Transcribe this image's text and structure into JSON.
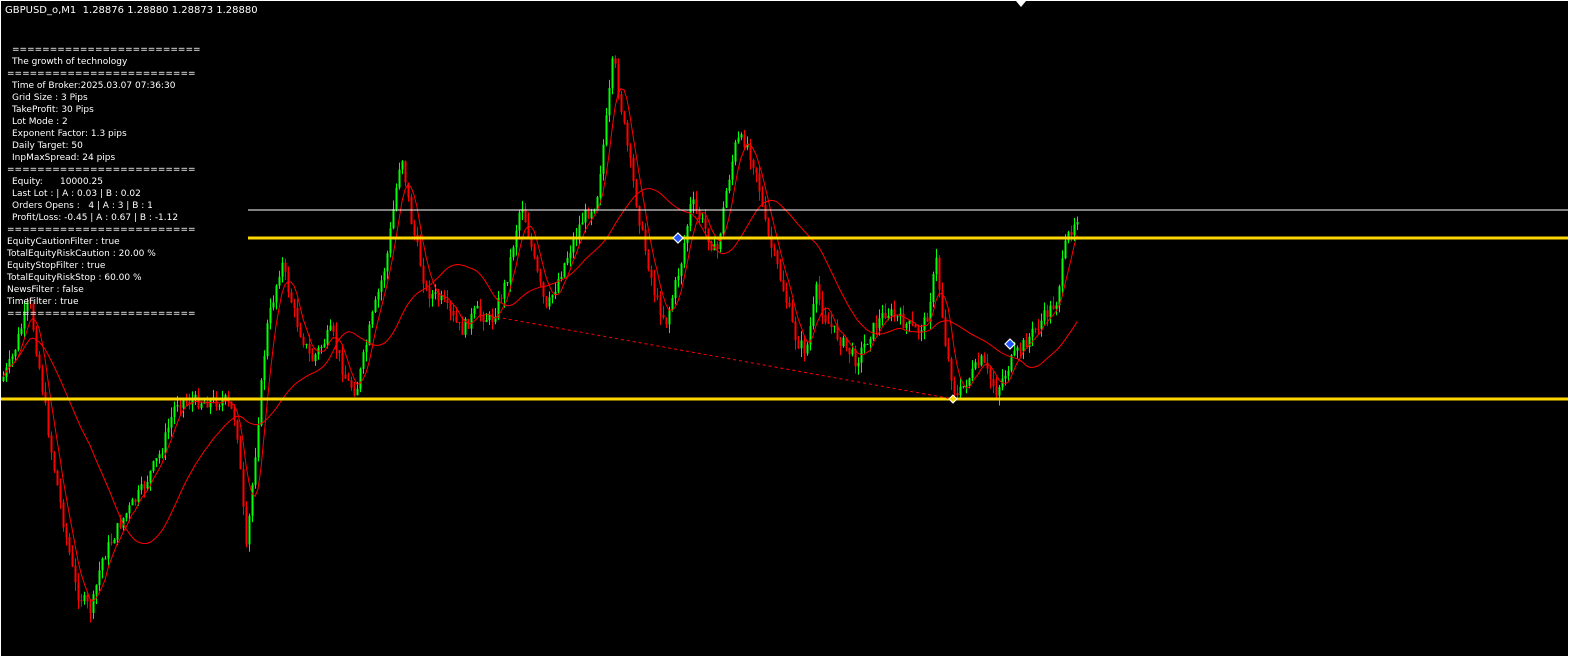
{
  "header": {
    "symbol": "GBPUSD_o,M1",
    "quote": "1.28876 1.28880 1.28873 1.28880"
  },
  "info_panel": {
    "sep_a": "=========================",
    "title": "The growth of technology",
    "sep_b": "=========================",
    "settings": [
      "Time of Broker:2025.03.07 07:36:30",
      "Grid Size : 3 Pips",
      "TakeProfit: 30 Pips",
      "Lot Mode : 2",
      "Exponent Factor: 1.3 pips",
      "Daily Target: 50",
      "InpMaxSpread: 24 pips"
    ],
    "sep_c": "=========================",
    "stats": [
      "Equity:      10000.25",
      "Last Lot : | A : 0.03 | B : 0.02",
      "Orders Opens :   4 | A : 3 | B : 1",
      "Profit/Loss: -0.45 | A : 0.67 | B : -1.12"
    ],
    "sep_d": "=========================",
    "filters": [
      "EquityCautionFilter : true",
      "TotalEquityRiskCaution : 20.00 %",
      "EquityStopFilter : true",
      "TotalEquityRiskStop : 60.00 %",
      "NewsFilter : false",
      "TimeFilter : true"
    ],
    "sep_e": "========================="
  },
  "colors": {
    "bull": "#00ff00",
    "bear": "#ff0000",
    "ma": "#ff0000",
    "level": "#ffd700",
    "hline": "#ffffff",
    "background": "#000000"
  }
}
